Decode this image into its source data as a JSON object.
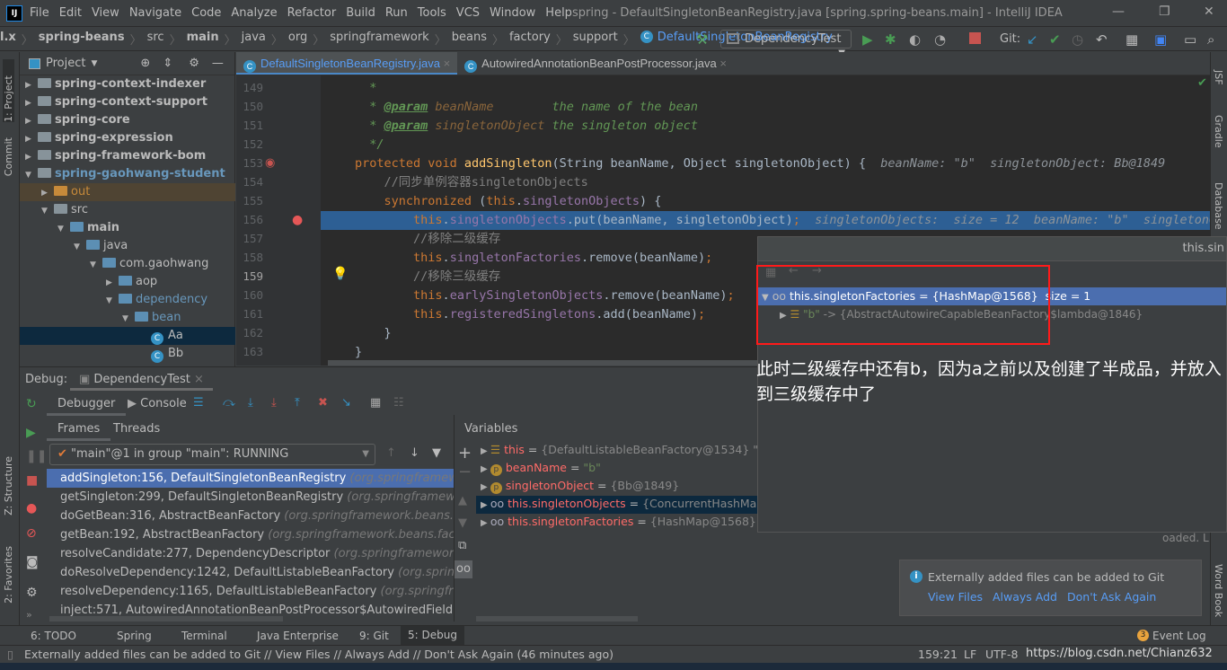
{
  "menu": {
    "items": [
      "File",
      "Edit",
      "View",
      "Navigate",
      "Code",
      "Analyze",
      "Refactor",
      "Build",
      "Run",
      "Tools",
      "VCS",
      "Window",
      "Help"
    ],
    "title": "spring - DefaultSingletonBeanRegistry.java [spring.spring-beans.main] - IntelliJ IDEA"
  },
  "nav": {
    "crumbs": [
      "l.x",
      "spring-beans",
      "src",
      "main",
      "java",
      "org",
      "springframework",
      "beans",
      "factory",
      "support",
      "DefaultSingletonBeanRegistry"
    ],
    "run_config": "DependencyTest",
    "git_label": "Git:"
  },
  "project": {
    "title": "Project",
    "items": [
      {
        "label": "spring-context-indexer",
        "depth": 1,
        "kind": "module",
        "bold": true
      },
      {
        "label": "spring-context-support",
        "depth": 1,
        "kind": "module",
        "bold": true
      },
      {
        "label": "spring-core",
        "depth": 1,
        "kind": "module",
        "bold": true
      },
      {
        "label": "spring-expression",
        "depth": 1,
        "kind": "module",
        "bold": true
      },
      {
        "label": "spring-framework-bom",
        "depth": 1,
        "kind": "module",
        "bold": true
      },
      {
        "label": "spring-gaohwang-student",
        "depth": 1,
        "kind": "module",
        "bold": true,
        "open": true
      },
      {
        "label": "out",
        "depth": 2,
        "kind": "out"
      },
      {
        "label": "src",
        "depth": 2,
        "kind": "folder",
        "open": true
      },
      {
        "label": "main",
        "depth": 3,
        "kind": "src",
        "open": true,
        "bold": true
      },
      {
        "label": "java",
        "depth": 4,
        "kind": "src",
        "open": true
      },
      {
        "label": "com.gaohwang",
        "depth": 5,
        "kind": "pkg",
        "open": true
      },
      {
        "label": "aop",
        "depth": 6,
        "kind": "pkg"
      },
      {
        "label": "dependency",
        "depth": 6,
        "kind": "pkg",
        "open": true
      },
      {
        "label": "bean",
        "depth": 7,
        "kind": "pkg",
        "open": true
      },
      {
        "label": "Aa",
        "depth": 8,
        "kind": "class",
        "selected": true
      },
      {
        "label": "Bb",
        "depth": 8,
        "kind": "class"
      }
    ]
  },
  "editor": {
    "tabs": [
      {
        "label": "DefaultSingletonBeanRegistry.java",
        "active": true
      },
      {
        "label": "AutowiredAnnotationBeanPostProcessor.java"
      }
    ],
    "lines": [
      {
        "n": "149",
        "tokens": [
          {
            "t": "  * ",
            "k": "doc"
          }
        ]
      },
      {
        "n": "150",
        "tokens": [
          {
            "t": "  * ",
            "k": "doc"
          },
          {
            "t": "@param",
            "k": "tag"
          },
          {
            "t": " beanName",
            "k": "par"
          },
          {
            "t": "        the name of the bean",
            "k": "doc"
          }
        ]
      },
      {
        "n": "151",
        "tokens": [
          {
            "t": "  * ",
            "k": "doc"
          },
          {
            "t": "@param",
            "k": "tag"
          },
          {
            "t": " singletonObject",
            "k": "par"
          },
          {
            "t": " the singleton object",
            "k": "doc"
          }
        ]
      },
      {
        "n": "152",
        "tokens": [
          {
            "t": "  */",
            "k": "doc"
          }
        ]
      },
      {
        "n": "153",
        "tokens": [
          {
            "t": "protected void ",
            "k": "kw"
          },
          {
            "t": "addSingleton",
            "k": "fn"
          },
          {
            "t": "(String beanName, Object singletonObject) {",
            "k": "id"
          },
          {
            "t": "  beanName: \"b\"  singletonObject: Bb@1849",
            "k": "hint"
          }
        ]
      },
      {
        "n": "154",
        "tokens": [
          {
            "t": "    //同步单例容器singletonObjects",
            "k": "cm"
          }
        ]
      },
      {
        "n": "155",
        "tokens": [
          {
            "t": "    synchronized ",
            "k": "kw"
          },
          {
            "t": "(",
            "k": "id"
          },
          {
            "t": "this",
            "k": "kw"
          },
          {
            "t": ".",
            "k": "id"
          },
          {
            "t": "singletonObjects",
            "k": "fld"
          },
          {
            "t": ") {",
            "k": "id"
          }
        ]
      },
      {
        "n": "156",
        "tokens": [
          {
            "t": "        this",
            "k": "kw"
          },
          {
            "t": ".",
            "k": "id"
          },
          {
            "t": "singletonObjects",
            "k": "fld"
          },
          {
            "t": ".put(beanName, singletonObject)",
            "k": "id"
          },
          {
            "t": ";",
            "k": "kw"
          },
          {
            "t": "  singletonObjects:  size = 12  beanName: \"b\"  singletonObject",
            "k": "hint"
          }
        ]
      },
      {
        "n": "157",
        "tokens": [
          {
            "t": "        //移除二级缓存",
            "k": "cm"
          }
        ]
      },
      {
        "n": "158",
        "tokens": [
          {
            "t": "        this",
            "k": "kw"
          },
          {
            "t": ".",
            "k": "id"
          },
          {
            "t": "singletonFactories",
            "k": "fld"
          },
          {
            "t": ".remove(beanName)",
            "k": "id"
          },
          {
            "t": ";",
            "k": "kw"
          }
        ]
      },
      {
        "n": "159",
        "tokens": [
          {
            "t": "        //移除三级缓存",
            "k": "cm"
          }
        ]
      },
      {
        "n": "160",
        "tokens": [
          {
            "t": "        this",
            "k": "kw"
          },
          {
            "t": ".",
            "k": "id"
          },
          {
            "t": "earlySingletonObjects",
            "k": "fld"
          },
          {
            "t": ".remove(beanName)",
            "k": "id"
          },
          {
            "t": ";",
            "k": "kw"
          }
        ]
      },
      {
        "n": "161",
        "tokens": [
          {
            "t": "        this",
            "k": "kw"
          },
          {
            "t": ".",
            "k": "id"
          },
          {
            "t": "registeredSingletons",
            "k": "fld"
          },
          {
            "t": ".add(beanName)",
            "k": "id"
          },
          {
            "t": ";",
            "k": "kw"
          }
        ]
      },
      {
        "n": "162",
        "tokens": [
          {
            "t": "    }",
            "k": "id"
          }
        ]
      },
      {
        "n": "163",
        "tokens": [
          {
            "t": "}",
            "k": "id"
          }
        ]
      }
    ]
  },
  "debug": {
    "label": "Debug:",
    "session": "DependencyTest",
    "tabs": [
      "Debugger",
      "Console"
    ],
    "subtabs": [
      "Frames",
      "Threads"
    ],
    "thread": "\"main\"@1 in group \"main\": RUNNING",
    "variables_title": "Variables",
    "frames": [
      {
        "method": "addSingleton:156, DefaultSingletonBeanRegistry",
        "pkg": "(org.springframework.beans"
      },
      {
        "method": "getSingleton:299, DefaultSingletonBeanRegistry",
        "pkg": "(org.springframework.bean"
      },
      {
        "method": "doGetBean:316, AbstractBeanFactory",
        "pkg": "(org.springframework.beans.factory.s"
      },
      {
        "method": "getBean:192, AbstractBeanFactory",
        "pkg": "(org.springframework.beans.factory.sup"
      },
      {
        "method": "resolveCandidate:277, DependencyDescriptor",
        "pkg": "(org.springframework.beans"
      },
      {
        "method": "doResolveDependency:1242, DefaultListableBeanFactory",
        "pkg": "(org.springframew"
      },
      {
        "method": "resolveDependency:1165, DefaultListableBeanFactory",
        "pkg": "(org.springframewor"
      },
      {
        "method": "inject:571, AutowiredAnnotationBeanPostProcessor$AutowiredFieldElement",
        "pkg": ""
      }
    ],
    "variables": [
      {
        "name": "this",
        "value": "{DefaultListableBeanFactory@1534} \"org.",
        "icon": "fields-icon"
      },
      {
        "name": "beanName",
        "value": "\"b\"",
        "icon": "param-icon",
        "string": true
      },
      {
        "name": "singletonObject",
        "value": "{Bb@1849}",
        "icon": "param-icon"
      },
      {
        "name": "this.singletonObjects",
        "value": "{ConcurrentHashMap@",
        "icon": "watch-icon",
        "selected": true
      },
      {
        "name": "this.singletonFactories",
        "value": "{HashMap@1568}",
        "extra": "size",
        "icon": "watch-icon"
      }
    ]
  },
  "popup": {
    "title": "this.sin",
    "root": {
      "name": "this.singletonFactories",
      "value": "{HashMap@1568}",
      "size": "size = 1"
    },
    "child": {
      "key": "\"b\"",
      "value": "-> {AbstractAutowireCapableBeanFactory$lambda@1846}"
    },
    "loaded_text": "oaded. L"
  },
  "annotation": {
    "text": "此时二级缓存中还有b，因为a之前以及创建了半成品，并放入到三级缓存中了",
    "color": "#ff1a1a"
  },
  "notification": {
    "text": "Externally added files can be added to Git",
    "actions": [
      "View Files",
      "Always Add",
      "Don't Ask Again"
    ]
  },
  "bottom_tabs": [
    "6: TODO",
    "Spring",
    "Terminal",
    "Java Enterprise",
    "9: Git",
    "5: Debug"
  ],
  "event_log": "Event Log",
  "event_count": "3",
  "status": {
    "message": "Externally added files can be added to Git // View Files // Always Add // Don't Ask Again (46 minutes ago)",
    "position": "159:21",
    "line_sep": "LF",
    "encoding": "UTF-8",
    "watermark": "https://blog.csdn.net/Chianz632"
  },
  "side": {
    "left": [
      "1: Project",
      "Commit",
      "Z: Structure",
      "2: Favorites"
    ],
    "right": [
      "JSF",
      "Gradle",
      "Database",
      "Word Book"
    ]
  }
}
